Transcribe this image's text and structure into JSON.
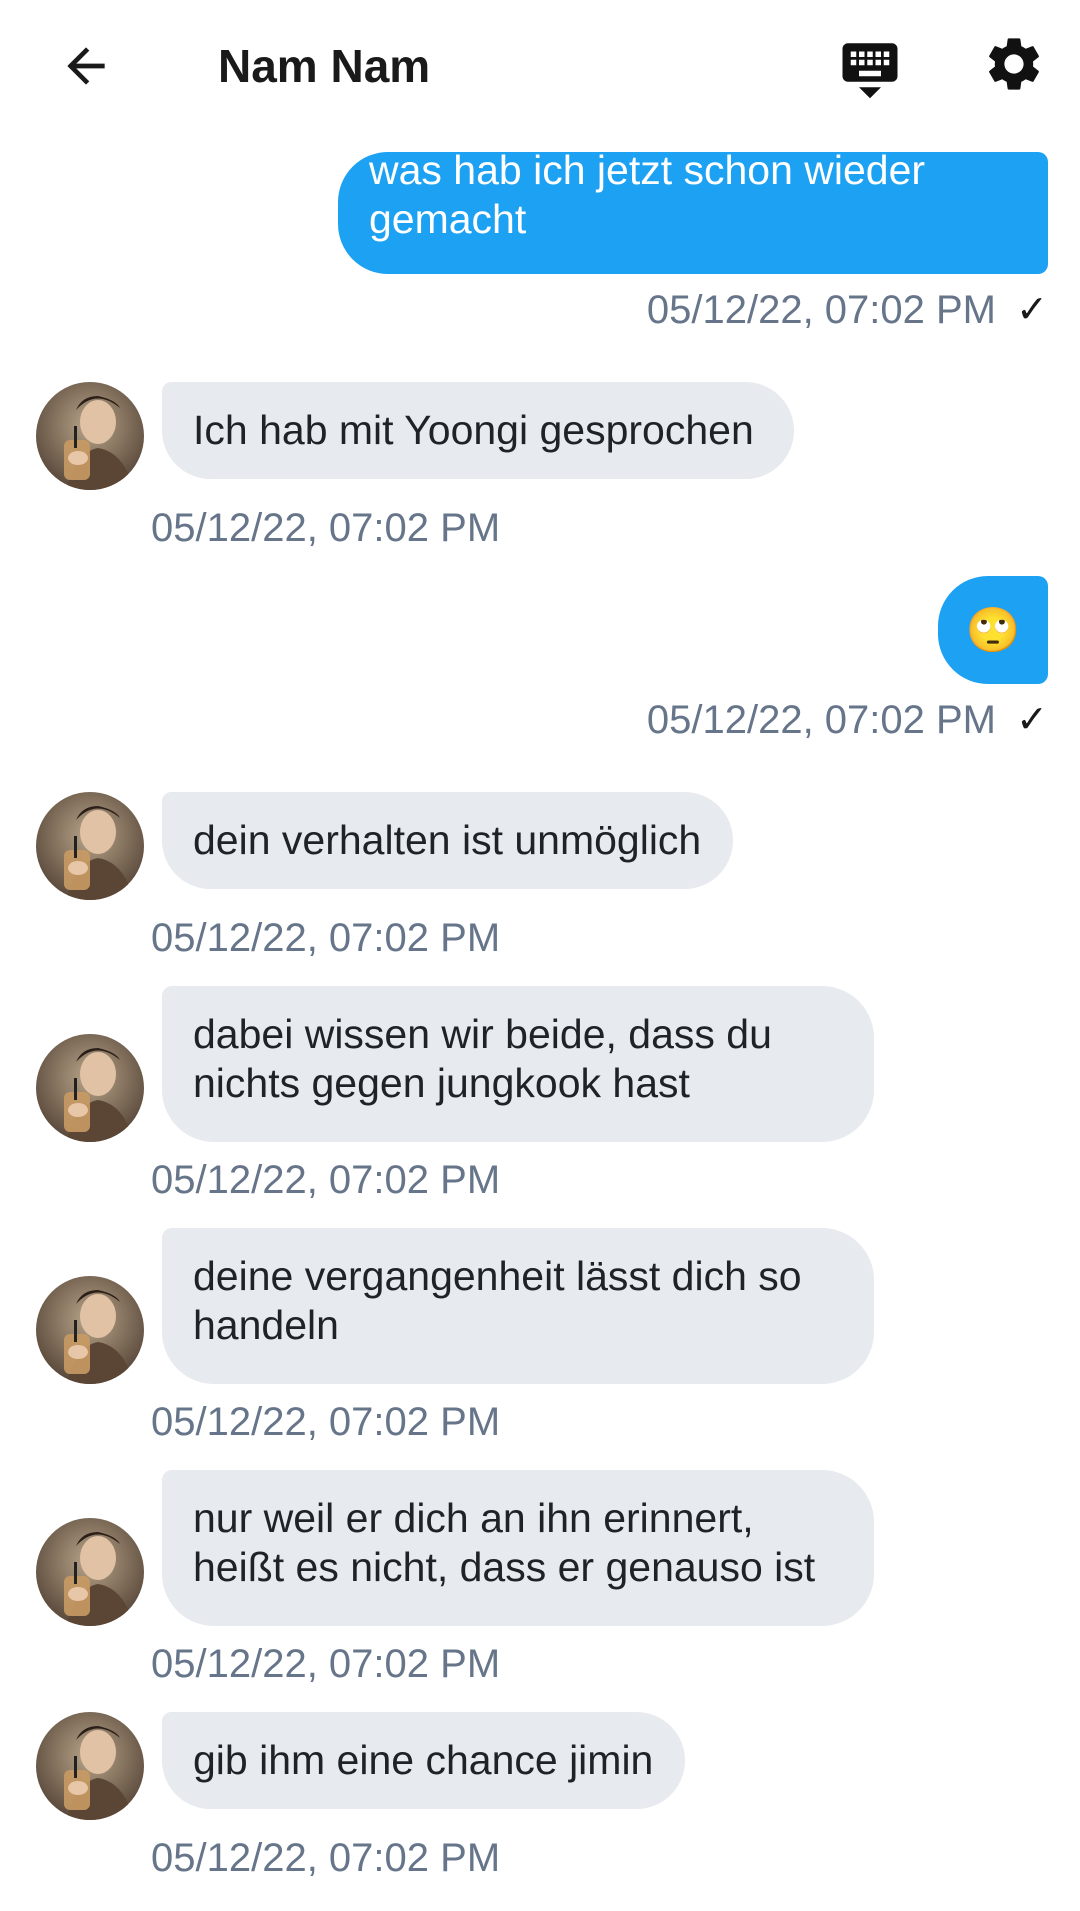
{
  "header": {
    "title": "Nam Nam",
    "back_icon": "arrow-left-icon",
    "keyboard_icon": "keyboard-hide-icon",
    "settings_icon": "gear-icon"
  },
  "colors": {
    "outgoing_bubble": "#1da1f2",
    "incoming_bubble": "#e7eaee",
    "timestamp": "#66758a"
  },
  "messages": [
    {
      "direction": "outgoing",
      "text": "was hab ich jetzt schon wieder gemacht",
      "time": "05/12/22, 07:02 PM",
      "status": "✓"
    },
    {
      "direction": "incoming",
      "text": "Ich hab mit Yoongi gesprochen",
      "time": "05/12/22, 07:02 PM"
    },
    {
      "direction": "outgoing",
      "text": "🙄",
      "time": "05/12/22, 07:02 PM",
      "status": "✓"
    },
    {
      "direction": "incoming",
      "text": "dein verhalten ist unmöglich",
      "time": "05/12/22, 07:02 PM"
    },
    {
      "direction": "incoming",
      "text": "dabei wissen wir beide, dass du nichts gegen jungkook hast",
      "time": "05/12/22, 07:02 PM"
    },
    {
      "direction": "incoming",
      "text": "deine vergangenheit lässt dich so handeln",
      "time": "05/12/22, 07:02 PM"
    },
    {
      "direction": "incoming",
      "text": "nur weil er dich an ihn erinnert, heißt es nicht, dass er genauso ist",
      "time": "05/12/22, 07:02 PM"
    },
    {
      "direction": "incoming",
      "text": "gib ihm eine chance jimin",
      "time": "05/12/22, 07:02 PM"
    }
  ]
}
